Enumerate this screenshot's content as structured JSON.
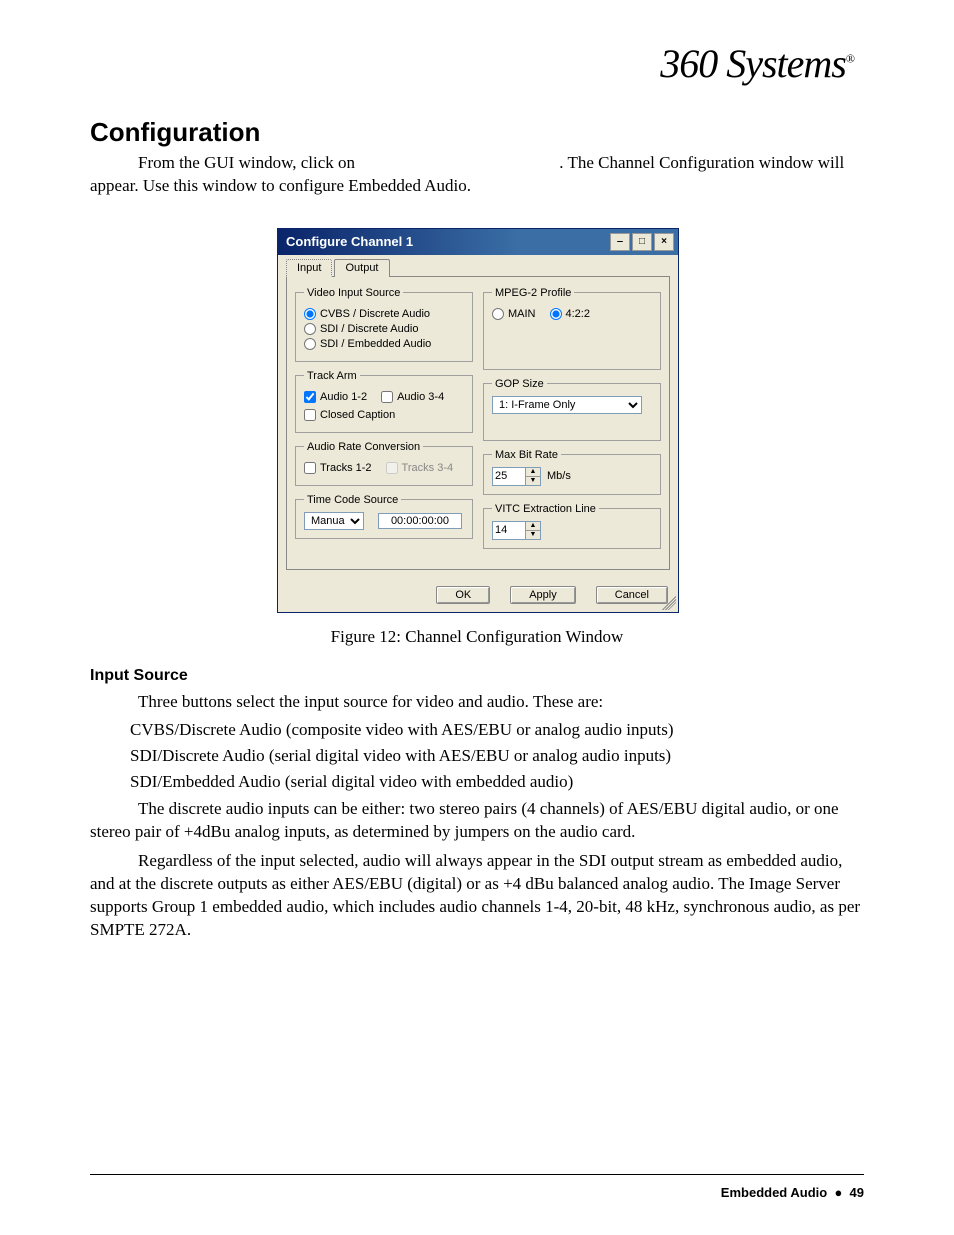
{
  "logo_text": "360 Systems",
  "logo_reg": "®",
  "heading": "Configuration",
  "intro1": "From the GUI window, click on",
  "intro2": ".  The Channel Configuration window will appear.  Use this window to configure Embedded Audio.",
  "dialog": {
    "title": "Configure Channel 1",
    "tabs": {
      "input": "Input",
      "output": "Output"
    },
    "groups": {
      "video_input_source": {
        "legend": "Video Input Source",
        "opt1": "CVBS / Discrete Audio",
        "opt2": "SDI / Discrete Audio",
        "opt3": "SDI / Embedded Audio"
      },
      "track_arm": {
        "legend": "Track Arm",
        "opt1": "Audio 1-2",
        "opt2": "Audio 3-4",
        "opt3": "Closed Caption"
      },
      "audio_rate_conversion": {
        "legend": "Audio Rate Conversion",
        "opt1": "Tracks 1-2",
        "opt2": "Tracks 3-4"
      },
      "time_code_source": {
        "legend": "Time Code Source",
        "mode": "Manual",
        "value": "00:00:00:00"
      },
      "mpeg2_profile": {
        "legend": "MPEG-2 Profile",
        "opt1": "MAIN",
        "opt2": "4:2:2"
      },
      "gop_size": {
        "legend": "GOP Size",
        "value": "1: I-Frame Only"
      },
      "max_bit_rate": {
        "legend": "Max Bit Rate",
        "value": "25",
        "unit": "Mb/s"
      },
      "vitc": {
        "legend": "VITC Extraction Line",
        "value": "14"
      }
    },
    "buttons": {
      "ok": "OK",
      "apply": "Apply",
      "cancel": "Cancel"
    }
  },
  "figure_caption": "Figure 12:  Channel Configuration Window",
  "input_source_heading": "Input Source",
  "is_intro": "Three buttons select the input source for video and audio.  These are:",
  "is_opt1": "CVBS/Discrete Audio (composite video with AES/EBU or analog audio inputs)",
  "is_opt2": "SDI/Discrete Audio (serial digital video with AES/EBU or analog audio inputs)",
  "is_opt3": "SDI/Embedded Audio (serial digital video with embedded audio)",
  "para2": "The discrete audio inputs can be either: two stereo pairs (4 channels) of AES/EBU digital audio, or one stereo pair of +4dBu analog inputs, as determined by jumpers on the audio card.",
  "para3": "Regardless of the input selected, audio will always appear in the SDI output stream as embedded audio, and at the discrete outputs as either AES/EBU (digital) or as +4 dBu balanced analog audio.  The Image Server supports Group 1 embedded audio, which includes audio channels 1-4, 20-bit, 48 kHz, synchronous audio, as per SMPTE 272A.",
  "footer_section": "Embedded Audio",
  "footer_bullet": "●",
  "footer_page": "49"
}
